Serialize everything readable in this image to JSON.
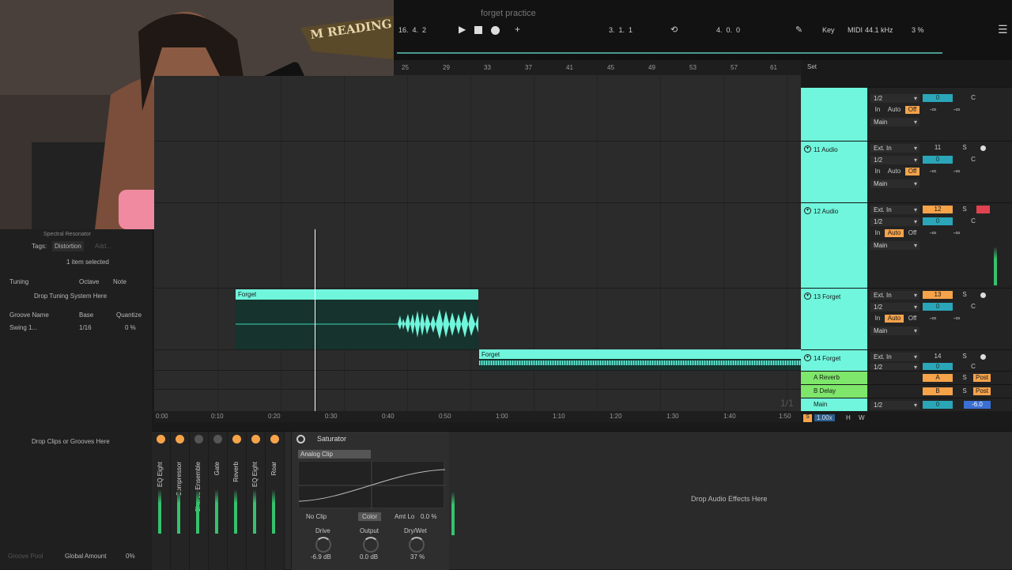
{
  "webcam": {
    "sign_text": "M READING"
  },
  "project": {
    "title": "forget practice"
  },
  "transport": {
    "position": "16.  4.  2",
    "loop_start": "3.  1.  1",
    "loop_length": "4.  0.  0",
    "key_label": "Key",
    "midi_label": "MIDI",
    "sample_rate": "44.1 kHz",
    "cpu": "3 %"
  },
  "ruler": {
    "bars": [
      "25",
      "29",
      "33",
      "37",
      "41",
      "45",
      "49",
      "53",
      "57",
      "61"
    ],
    "set_label": "Set"
  },
  "time_ruler": [
    "0:00",
    "0:10",
    "0:20",
    "0:30",
    "0:40",
    "0:50",
    "1:00",
    "1:10",
    "1:20",
    "1:30",
    "1:40",
    "1:50"
  ],
  "clips": [
    {
      "name": "Forget"
    },
    {
      "name": "Forget"
    }
  ],
  "tracks": [
    {
      "name": "",
      "input": "",
      "channel": "1/2",
      "number": "",
      "pan": "C",
      "vol": "0",
      "monitor": [
        "In",
        "Auto",
        "Off"
      ],
      "out": "Main",
      "inf1": "-∞",
      "inf2": "-∞"
    },
    {
      "name": "11 Audio",
      "input": "Ext. In",
      "channel": "1/2",
      "number": "11",
      "pan": "C",
      "vol": "0",
      "monitor": [
        "In",
        "Auto",
        "Off"
      ],
      "out": "Main",
      "inf1": "-∞",
      "inf2": "-∞"
    },
    {
      "name": "12 Audio",
      "input": "Ext. In",
      "channel": "1/2",
      "number": "12",
      "pan": "C",
      "vol": "0",
      "monitor": [
        "In",
        "Auto",
        "Off"
      ],
      "out": "Main",
      "inf1": "-∞",
      "inf2": "-∞"
    },
    {
      "name": "13 Forget",
      "input": "Ext. In",
      "channel": "1/2",
      "number": "13",
      "pan": "C",
      "vol": "0",
      "monitor": [
        "In",
        "Auto",
        "Off"
      ],
      "out": "Main",
      "inf1": "-∞",
      "inf2": "-∞"
    },
    {
      "name": "14 Forget",
      "input": "Ext. In",
      "channel": "1/2",
      "number": "14",
      "pan": "C",
      "vol": "0"
    }
  ],
  "returns": [
    {
      "name": "A Reverb",
      "letter": "A",
      "post": "Post"
    },
    {
      "name": "B Delay",
      "letter": "B",
      "post": "Post"
    }
  ],
  "main": {
    "name": "Main",
    "channel": "1/2",
    "vol": "0",
    "db": "-6.0"
  },
  "bottom_status": {
    "page": "1/1",
    "zoom": "1.00x",
    "h": "H",
    "w": "W",
    "solo": "S"
  },
  "left_panel": {
    "device_name": "Spectral Resonator",
    "tags_label": "Tags:",
    "tag": "Distortion",
    "add": "Add...",
    "selected": "1 item selected",
    "tuning": "Tuning",
    "octave": "Octave",
    "note": "Note",
    "drop_tuning": "Drop Tuning System Here",
    "groove_name": "Groove Name",
    "base": "Base",
    "quantize": "Quantize",
    "groove_item": "Swing 1...",
    "groove_base": "1/16",
    "groove_q": "0 %",
    "drop_clips": "Drop Clips or Grooves Here",
    "groove_pool": "Groove Pool",
    "global_amount": "Global Amount",
    "global_value": "0%"
  },
  "devices": {
    "chain": [
      {
        "name": "EQ Eight",
        "on": true
      },
      {
        "name": "Compressor",
        "on": true
      },
      {
        "name": "Chorus-Ensemble",
        "on": false
      },
      {
        "name": "Gate",
        "on": false
      },
      {
        "name": "Reverb",
        "on": true
      },
      {
        "name": "EQ Eight",
        "on": true
      },
      {
        "name": "Roar",
        "on": true
      }
    ],
    "saturator": {
      "title": "Saturator",
      "type": "Analog Clip",
      "clip_mode": "No Clip",
      "color": "Color",
      "amt_lo": "Amt Lo",
      "amt_lo_value": "0.0 %",
      "drive_label": "Drive",
      "drive_value": "-6.9 dB",
      "output_label": "Output",
      "output_value": "0.0 dB",
      "drywet_label": "Dry/Wet",
      "drywet_value": "37 %"
    },
    "drop_effects": "Drop Audio Effects Here"
  }
}
